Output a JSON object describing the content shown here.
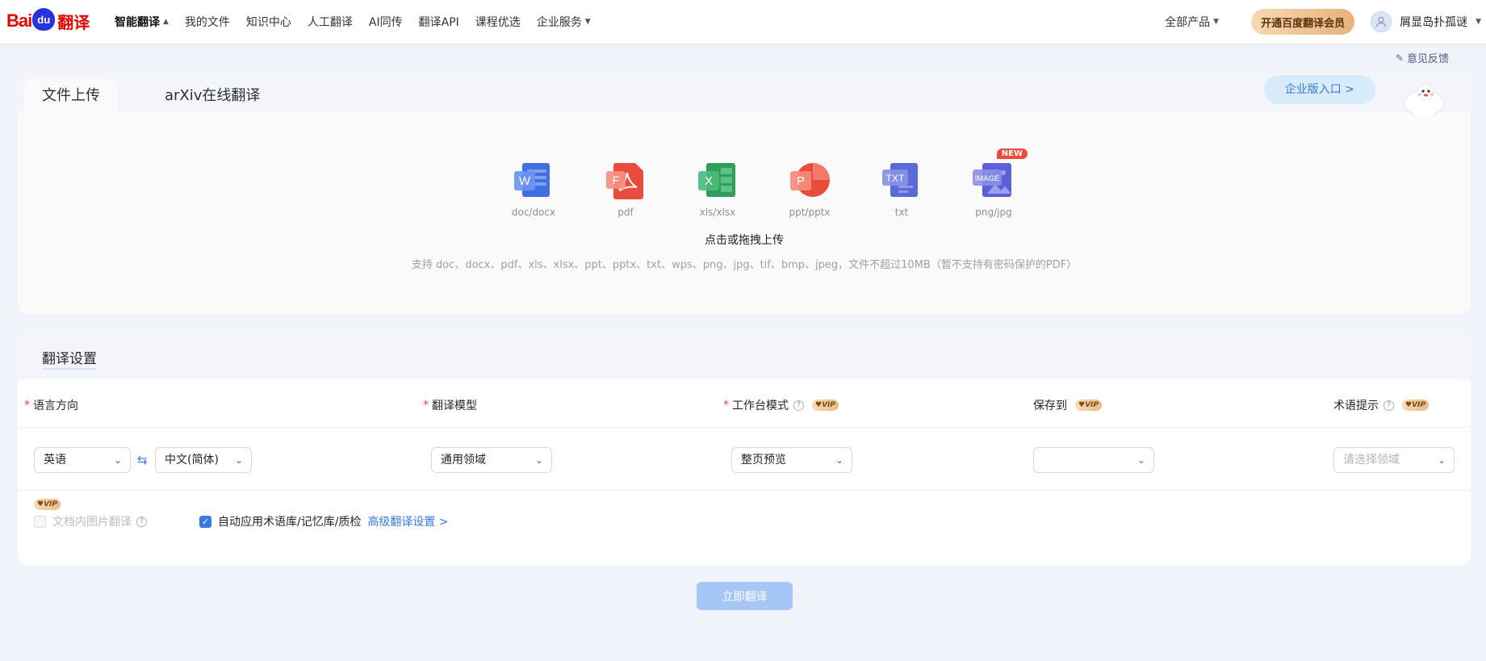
{
  "header": {
    "logo_text_1": "Bai",
    "logo_text_2": "du",
    "logo_text_3": "翻译",
    "nav": [
      {
        "label": "智能翻译",
        "active": true,
        "caret": "▲"
      },
      {
        "label": "我的文件"
      },
      {
        "label": "知识中心"
      },
      {
        "label": "人工翻译"
      },
      {
        "label": "AI同传"
      },
      {
        "label": "翻译API"
      },
      {
        "label": "课程优选"
      },
      {
        "label": "企业服务",
        "caret": "▼"
      }
    ],
    "all_products": "全部产品",
    "vip_button": "开通百度翻译会员",
    "username": "屑显岛扑孤谜",
    "feedback": "意见反馈"
  },
  "upload": {
    "tabs": [
      "文件上传",
      "arXiv在线翻译"
    ],
    "enterprise_entry": "企业版入口 >",
    "file_types": [
      {
        "label": "doc/docx",
        "glyph": "W",
        "color": "#3f6fe0",
        "icon": "word-icon"
      },
      {
        "label": "pdf",
        "glyph": "F",
        "color": "#e74c3c",
        "icon": "pdf-icon"
      },
      {
        "label": "xls/xlsx",
        "glyph": "X",
        "color": "#2f9d5c",
        "icon": "excel-icon"
      },
      {
        "label": "ppt/pptx",
        "glyph": "P",
        "color": "#ea4b3a",
        "icon": "ppt-icon"
      },
      {
        "label": "txt",
        "glyph": "TXT",
        "color": "#5a6ad6",
        "icon": "txt-icon"
      },
      {
        "label": "png/jpg",
        "glyph": "IMAGE",
        "color": "#5d5fd8",
        "icon": "image-icon",
        "badge": "NEW"
      }
    ],
    "hint": "点击或拖拽上传",
    "support": "支持 doc、docx、pdf、xls、xlsx、ppt、pptx、txt、wps、png、jpg、tif、bmp、jpeg，文件不超过10MB（暂不支持有密码保护的PDF）"
  },
  "settings": {
    "title": "翻译设置",
    "labels": {
      "language": "语言方向",
      "model": "翻译模型",
      "workspace": "工作台模式",
      "save_to": "保存到",
      "terms": "术语提示"
    },
    "vip": "VIP",
    "selects": {
      "source_lang": "英语",
      "target_lang": "中文(简体)",
      "model": "通用领域",
      "workspace": "整页预览",
      "save_to": "",
      "terms_placeholder": "请选择领域"
    },
    "options": {
      "image_translate": "文档内图片翻译",
      "auto_apply": "自动应用术语库/记忆库/质检",
      "advanced": "高级翻译设置 >"
    }
  },
  "action": {
    "translate": "立即翻译"
  }
}
